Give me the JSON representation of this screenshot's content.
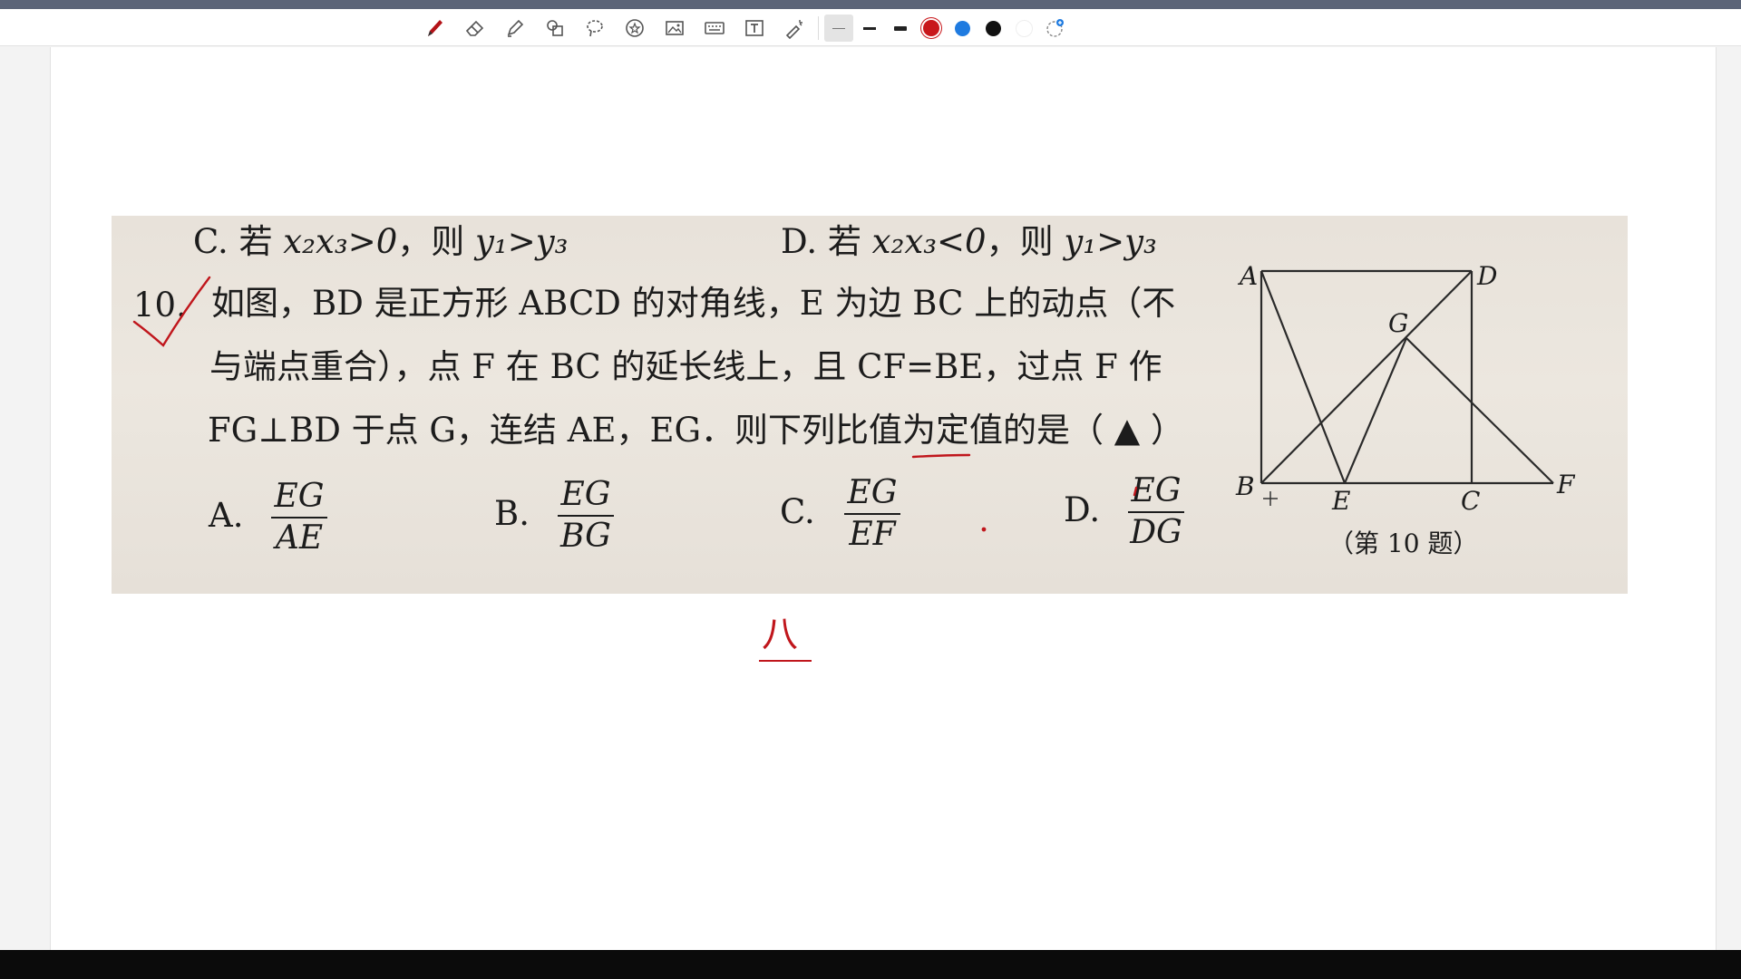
{
  "toolbar": {
    "tools": [
      {
        "name": "pen-icon"
      },
      {
        "name": "eraser-icon"
      },
      {
        "name": "highlighter-icon"
      },
      {
        "name": "shapes-icon"
      },
      {
        "name": "lasso-icon"
      },
      {
        "name": "sticker-icon"
      },
      {
        "name": "image-icon"
      },
      {
        "name": "keyboard-icon"
      },
      {
        "name": "textbox-icon"
      },
      {
        "name": "laser-pointer-icon"
      }
    ],
    "line_widths": [
      "thin",
      "medium",
      "thick"
    ],
    "colors": [
      "#c8171b",
      "#1f7be0",
      "#111111",
      "#ffffff"
    ]
  },
  "question": {
    "prev_option_c_label": "C.",
    "prev_option_c_if": "若",
    "prev_option_c_cond": "x₂x₃>0",
    "prev_option_c_then": "，则",
    "prev_option_c_result": "y₁>y₃",
    "prev_option_d_label": "D.",
    "prev_option_d_if": "若",
    "prev_option_d_cond": "x₂x₃<0",
    "prev_option_d_then": "，则",
    "prev_option_d_result": "y₁>y₃",
    "number": "10.",
    "line1": "如图，BD 是正方形 ABCD 的对角线，E 为边 BC 上的动点（不",
    "line2": "与端点重合），点 F 在 BC 的延长线上，且 CF=BE，过点 F 作",
    "line3": "FG⊥BD 于点 G，连结 AE，EG．则下列比值为定值的是（ ▲ ）",
    "options": [
      {
        "label": "A.",
        "num": "EG",
        "den": "AE"
      },
      {
        "label": "B.",
        "num": "EG",
        "den": "BG"
      },
      {
        "label": "C.",
        "num": "EG",
        "den": "EF"
      },
      {
        "label": "D.",
        "num": "EG",
        "den": "DG"
      }
    ]
  },
  "figure": {
    "points": {
      "A": "A",
      "B": "B",
      "C": "C",
      "D": "D",
      "E": "E",
      "F": "F",
      "G": "G"
    },
    "caption": "（第 10 题）"
  },
  "annotation": {
    "handwritten": "八"
  }
}
